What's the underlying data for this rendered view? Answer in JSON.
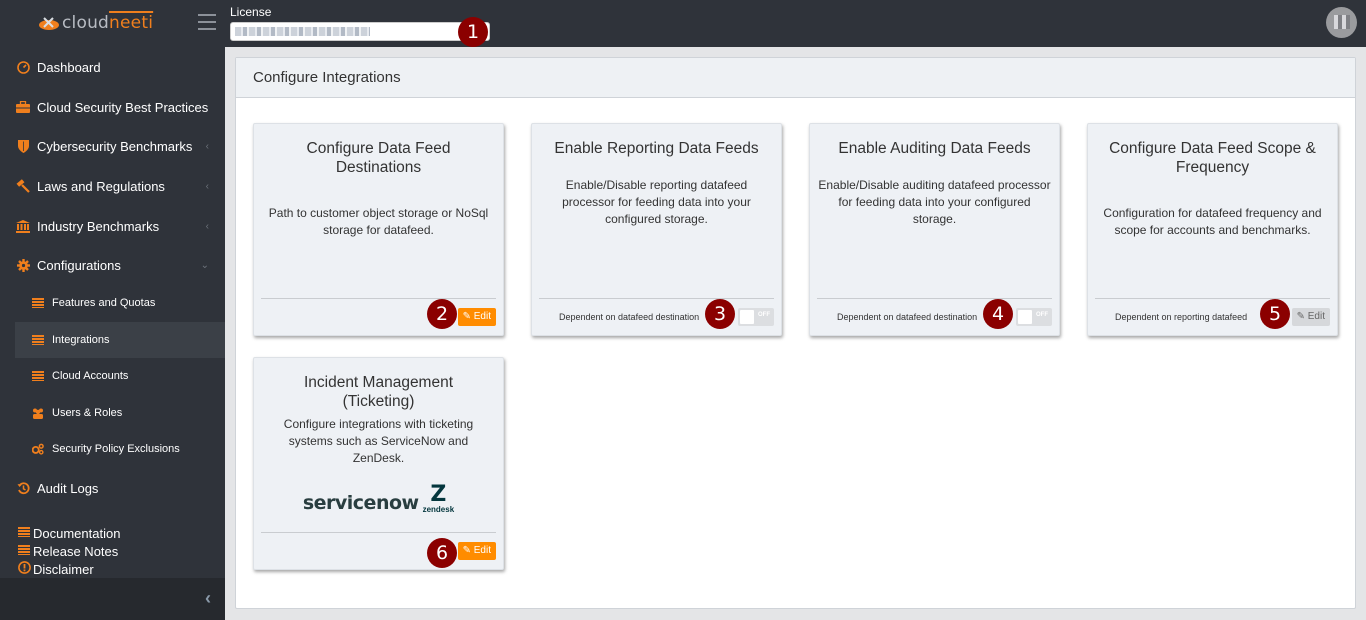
{
  "app": {
    "logo_part1": "cloud",
    "logo_part2": "neeti",
    "accent_color": "#f07f1d"
  },
  "topbar": {
    "license_label": "License",
    "license_value": "(blurred license value)",
    "avatar": "user-avatar-blurred"
  },
  "sidebar": {
    "items": [
      {
        "label": "Dashboard",
        "icon": "dashboard-gauge-icon"
      },
      {
        "label": "Cloud Security Best Practices",
        "icon": "briefcase-icon"
      },
      {
        "label": "Cybersecurity Benchmarks",
        "icon": "shield-icon",
        "chevron": "‹"
      },
      {
        "label": "Laws and Regulations",
        "icon": "gavel-icon",
        "chevron": "‹"
      },
      {
        "label": "Industry Benchmarks",
        "icon": "bank-icon",
        "chevron": "‹"
      },
      {
        "label": "Configurations",
        "icon": "gear-icon",
        "chevron": "⌄"
      }
    ],
    "sub_items": [
      {
        "label": "Features and Quotas",
        "icon": "list-icon"
      },
      {
        "label": "Integrations",
        "icon": "list-icon",
        "active": true
      },
      {
        "label": "Cloud Accounts",
        "icon": "list-icon"
      },
      {
        "label": "Users & Roles",
        "icon": "users-icon"
      },
      {
        "label": "Security Policy Exclusions",
        "icon": "gears-icon"
      }
    ],
    "audit_logs": "Audit Logs",
    "footer_links": [
      {
        "label": "Documentation",
        "icon": "list-icon"
      },
      {
        "label": "Release Notes",
        "icon": "list-icon"
      },
      {
        "label": "Disclaimer",
        "icon": "exclamation-circle-icon"
      }
    ],
    "collapse": "‹"
  },
  "main": {
    "title": "Configure Integrations",
    "cards": [
      {
        "title": "Configure Data Feed Destinations",
        "description": "Path to customer object storage or NoSql storage for datafeed.",
        "footer_text": "",
        "action": "Edit",
        "action_type": "button",
        "action_enabled": true
      },
      {
        "title": "Enable Reporting Data Feeds",
        "description": "Enable/Disable reporting datafeed processor for feeding data into your configured storage.",
        "footer_text": "Dependent on datafeed destination",
        "action": "OFF",
        "action_type": "toggle",
        "action_enabled": false
      },
      {
        "title": "Enable Auditing Data Feeds",
        "description": "Enable/Disable auditing datafeed processor for feeding data into your configured storage.",
        "footer_text": "Dependent on datafeed destination",
        "action": "OFF",
        "action_type": "toggle",
        "action_enabled": false
      },
      {
        "title": "Configure Data Feed Scope & Frequency",
        "description": "Configuration for datafeed frequency and scope for accounts and benchmarks.",
        "footer_text": "Dependent on reporting datafeed",
        "action": "Edit",
        "action_type": "button",
        "action_enabled": false
      },
      {
        "title": "Incident Management (Ticketing)",
        "description": "Configure integrations with ticketing systems such as ServiceNow and ZenDesk.",
        "footer_text": "",
        "logos": [
          "servicenow",
          "zendesk"
        ],
        "action": "Edit",
        "action_type": "button",
        "action_enabled": true
      }
    ]
  },
  "annotations": [
    "1",
    "2",
    "3",
    "4",
    "5",
    "6"
  ]
}
